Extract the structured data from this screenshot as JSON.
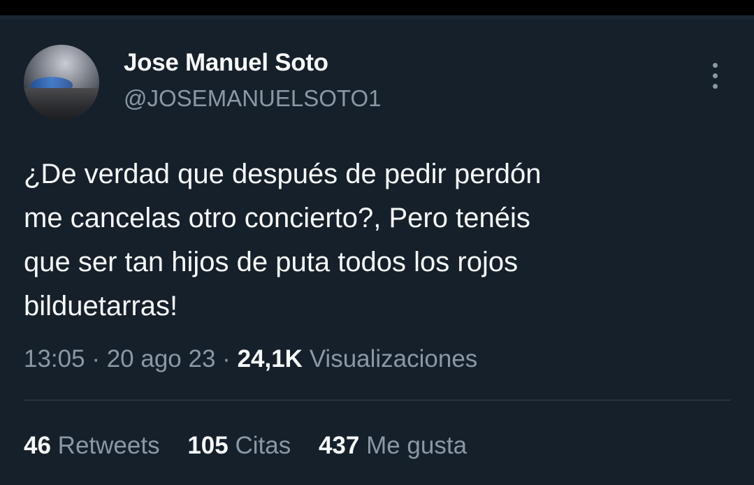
{
  "tweet": {
    "author": {
      "display_name": "Jose Manuel Soto",
      "handle": "@JOSEMANUELSOTO1"
    },
    "text": "¿De verdad que después de pedir perdón\nme cancelas otro concierto?, Pero tenéis\nque ser tan hijos de puta todos los rojos\nbilduetarras!",
    "time": "13:05",
    "date": "20 ago 23",
    "separator": "·",
    "views_count": "24,1K",
    "views_label": "Visualizaciones",
    "stats": {
      "retweets_count": "46",
      "retweets_label": "Retweets",
      "quotes_count": "105",
      "quotes_label": "Citas",
      "likes_count": "437",
      "likes_label": "Me gusta"
    }
  },
  "icons": {
    "more": "more-vertical-icon"
  },
  "colors": {
    "background": "#15202b",
    "primary_text": "#f7f9f9",
    "secondary_text": "#8b98a5",
    "divider": "#38444d"
  }
}
